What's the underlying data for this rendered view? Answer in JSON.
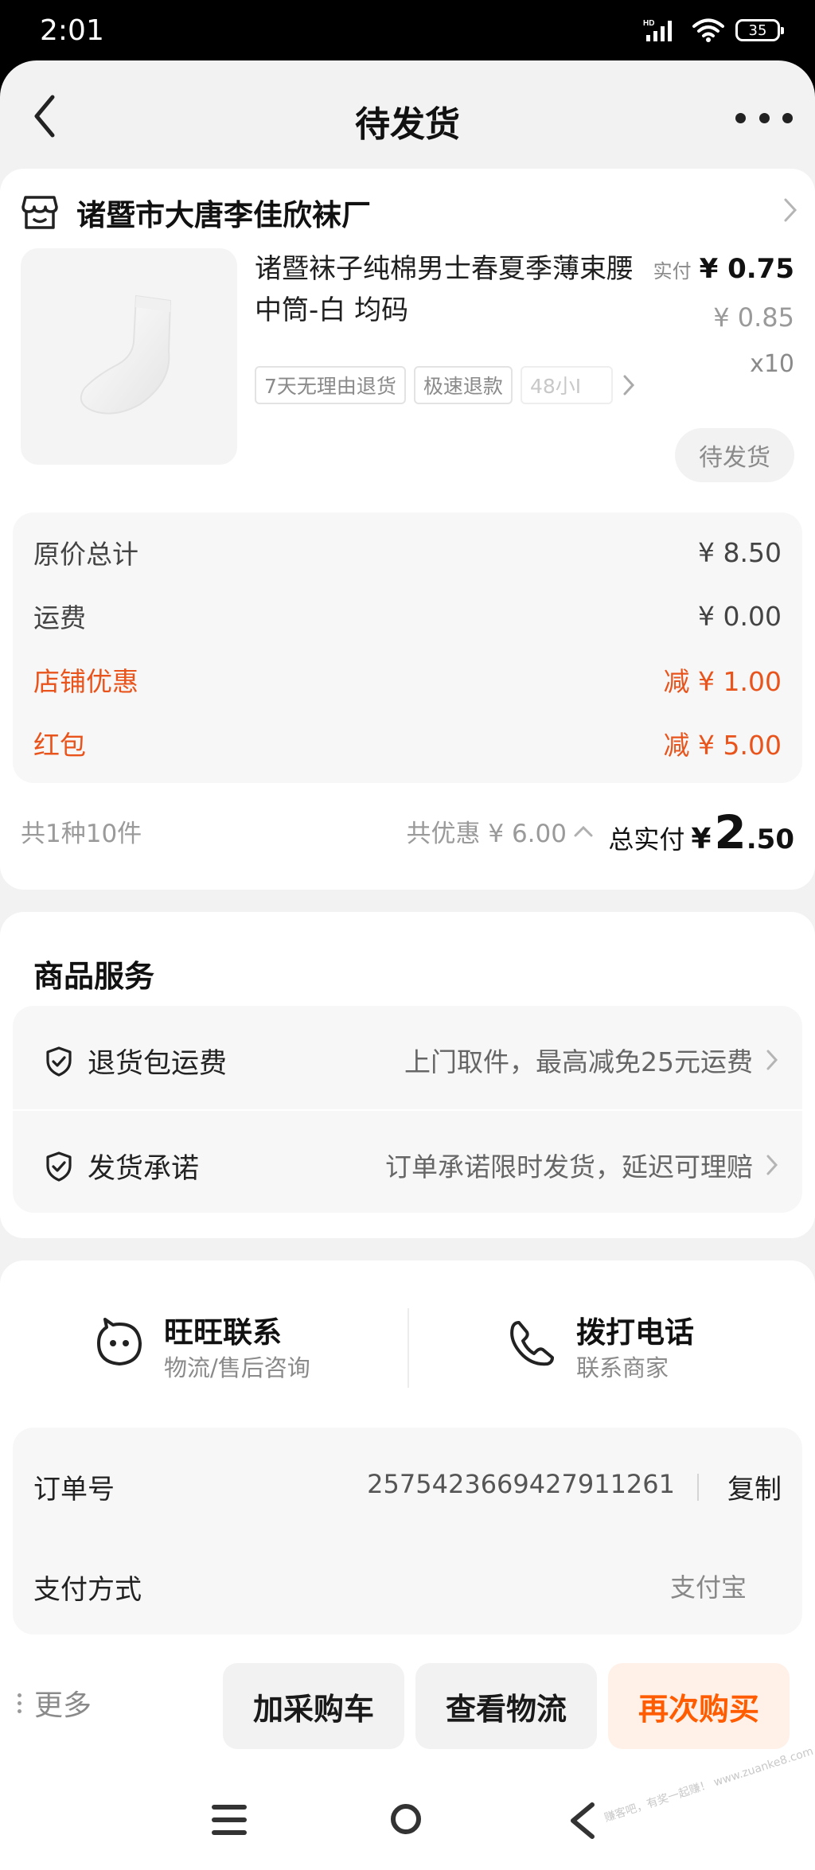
{
  "status_bar": {
    "time": "2:01",
    "network_label": "HD",
    "battery": "35"
  },
  "header": {
    "title": "待发货"
  },
  "order": {
    "shop": {
      "name": "诸暨市大唐李佳欣袜厂"
    },
    "item": {
      "title": "诸暨袜子纯棉男士春夏季薄束腰中筒-白 均码",
      "tags": [
        "7天无理由退货",
        "极速退款",
        "48小I"
      ],
      "paid_label": "实付",
      "paid_price": "¥ 0.75",
      "original_price": "¥ 0.85",
      "quantity": "x10",
      "status": "待发货"
    },
    "breakdown": [
      {
        "label": "原价总计",
        "value": "¥ 8.50",
        "color": "#444444"
      },
      {
        "label": "运费",
        "value": "¥ 0.00",
        "color": "#444444"
      },
      {
        "label": "店铺优惠",
        "value": "减 ¥ 1.00",
        "color": "#e8541c"
      },
      {
        "label": "红包",
        "value": "减 ¥ 5.00",
        "color": "#e8541c"
      }
    ],
    "summary": {
      "count": "共1种10件",
      "discount": "共优惠 ¥ 6.00",
      "total_label": "总实付",
      "total_currency": "¥",
      "total_integer": "2",
      "total_decimal": ".50"
    }
  },
  "services": {
    "title": "商品服务",
    "items": [
      {
        "name": "退货包运费",
        "desc": "上门取件，最高减免25元运费",
        "icon": "shield-check-icon"
      },
      {
        "name": "发货承诺",
        "desc": "订单承诺限时发货，延迟可理赔",
        "icon": "shield-check-icon"
      }
    ]
  },
  "contact": {
    "wangwang": {
      "title": "旺旺联系",
      "subtitle": "物流/售后咨询",
      "icon": "wangwang-icon"
    },
    "phone": {
      "title": "拨打电话",
      "subtitle": "联系商家",
      "icon": "phone-icon"
    }
  },
  "order_info": {
    "order_no_label": "订单号",
    "order_no": "2575423669427911261",
    "copy_label": "复制",
    "pay_method_label": "支付方式",
    "pay_method_value": "支付宝"
  },
  "actions": {
    "more": "更多",
    "add_cart": "加采购车",
    "logistics": "查看物流",
    "buy_again": "再次购买"
  },
  "colors": {
    "accent": "#ff5c00",
    "discount": "#e8541c",
    "background": "#f2f2f2"
  },
  "watermark": "赚客吧，有奖一起赚！ www.zuanke8.com"
}
